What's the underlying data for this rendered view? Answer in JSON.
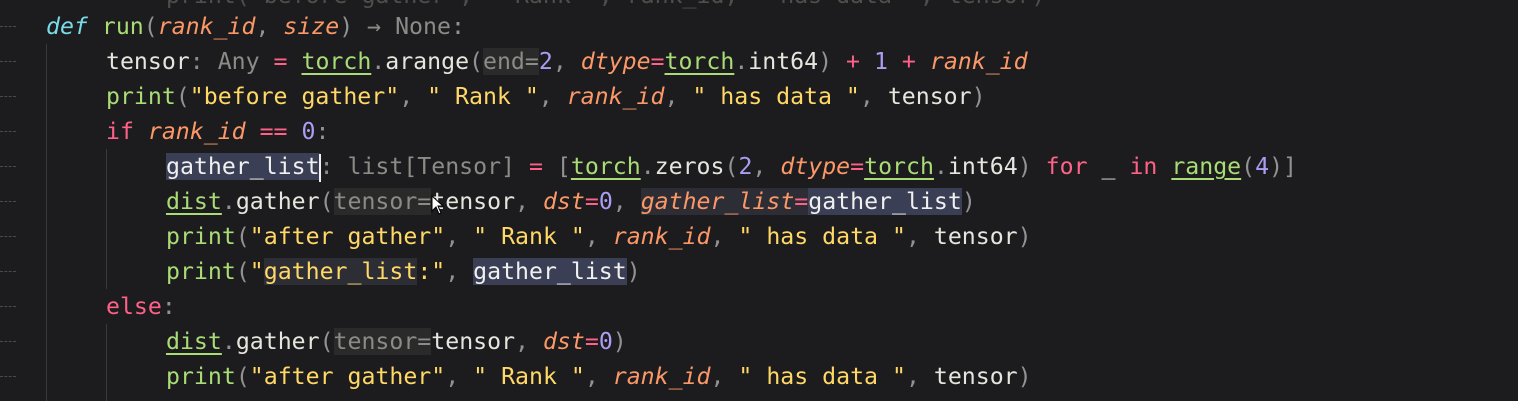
{
  "editor": {
    "top_partial": "print(\"before gather\", \" Rank \", rank_id, \" has data \", tensor)",
    "lines": {
      "l1": {
        "kw": "def",
        "fn": "run",
        "p1": "rank_id",
        "p2": "size",
        "ret": "None"
      },
      "l2": {
        "var": "tensor",
        "hint": "Any",
        "mod": "torch",
        "call": "arange",
        "arg_hint": "end=",
        "num1": "2",
        "kwarg": "dtype",
        "mod2": "torch",
        "attr": "int64",
        "num2": "1",
        "param": "rank_id"
      },
      "l3": {
        "fn": "print",
        "s1": "\"before gather\"",
        "s2": "\" Rank \"",
        "param": "rank_id",
        "s3": "\" has data \"",
        "var": "tensor"
      },
      "l4": {
        "kw": "if",
        "param": "rank_id",
        "op": "==",
        "num": "0"
      },
      "l5": {
        "var": "gather_list",
        "hint": "list[Tensor]",
        "mod": "torch",
        "call": "zeros",
        "num1": "2",
        "kwarg": "dtype",
        "mod2": "torch",
        "attr": "int64",
        "kw_for": "for",
        "under": "_",
        "kw_in": "in",
        "builtin": "range",
        "num2": "4"
      },
      "l6": {
        "mod": "dist",
        "call": "gather",
        "arg_hint": "tensor=",
        "var": "tensor",
        "kwarg1": "dst",
        "num": "0",
        "kwarg2": "gather_list",
        "val2": "gather_list"
      },
      "l7": {
        "fn": "print",
        "s1": "\"after gather\"",
        "s2": "\" Rank \"",
        "param": "rank_id",
        "s3": "\" has data \"",
        "var": "tensor"
      },
      "l8": {
        "fn": "print",
        "s1": "\"",
        "s1_hl": "gather_list",
        "s1_end": ":\"",
        "var": "gather_list"
      },
      "l9": {
        "kw": "else"
      },
      "l10": {
        "mod": "dist",
        "call": "gather",
        "arg_hint": "tensor=",
        "var": "tensor",
        "kwarg": "dst",
        "num": "0"
      },
      "l11": {
        "fn": "print",
        "s1": "\"after gather\"",
        "s2": "\" Rank \"",
        "param": "rank_id",
        "s3": "\" has data \"",
        "var": "tensor"
      }
    }
  },
  "colors": {
    "background": "#1c1c1e",
    "keyword": "#ff6188",
    "function": "#a9dc76",
    "parameter": "#fc9867",
    "string": "#ffd866",
    "number": "#ab9df2",
    "def_keyword": "#78dce8",
    "selection": "#3b3f55"
  },
  "icons": [
    "mouse-cursor-icon",
    "text-cursor"
  ]
}
